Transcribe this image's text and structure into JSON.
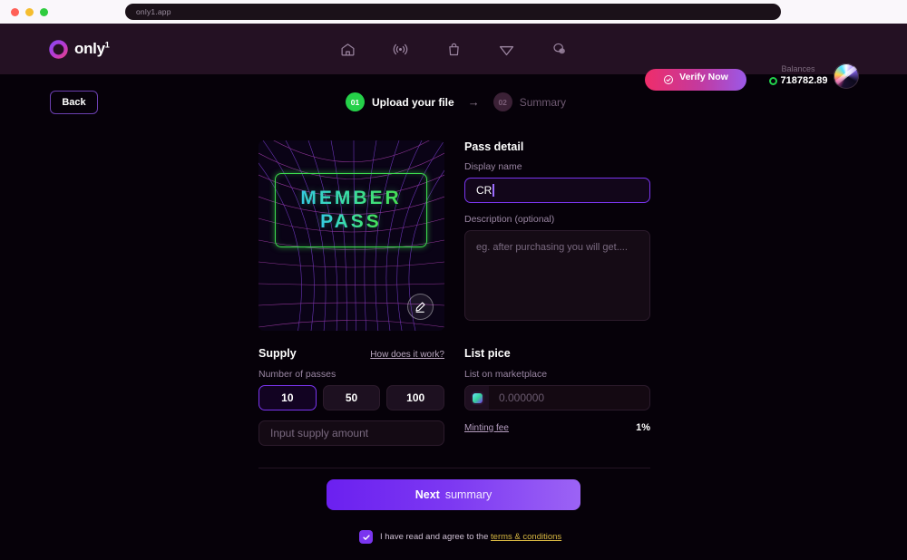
{
  "browser": {
    "url": "only1.app"
  },
  "header": {
    "logo_text": "only",
    "logo_sup": "1",
    "logo_icon": "only1-ring-logo",
    "nav": [
      {
        "name": "home-icon",
        "label": "Home"
      },
      {
        "name": "broadcast-icon",
        "label": "Live"
      },
      {
        "name": "shopping-bag-icon",
        "label": "Shop"
      },
      {
        "name": "diamond-icon",
        "label": "Gems"
      },
      {
        "name": "chat-bubbles-icon",
        "label": "Messages"
      }
    ],
    "verify_label": "Verify Now",
    "verify_icon": "check-circle-icon",
    "balances_label": "Balances",
    "balances_amount": "718782.89",
    "balances_icon": "like-token-icon",
    "avatar_name": "user-avatar"
  },
  "subheader": {
    "back_label": "Back",
    "steps": [
      {
        "number": "01",
        "label": "Upload your file",
        "active": true
      },
      {
        "number": "02",
        "label": "Summary",
        "active": false
      }
    ],
    "arrow": "→"
  },
  "preview": {
    "line1": "MEMBER",
    "line2": "PASS",
    "edit_icon": "pencil-edit-icon"
  },
  "pass_detail": {
    "title": "Pass detail",
    "display_name_label": "Display name",
    "display_name_value": "CR",
    "description_label": "Description (optional)",
    "description_placeholder": "eg. after purchasing you will get....",
    "description_value": ""
  },
  "supply": {
    "title": "Supply",
    "help_link": "How does it work?",
    "field_label": "Number of passes",
    "options": [
      "10",
      "50",
      "100"
    ],
    "selected": "10",
    "input_placeholder": "Input supply amount",
    "input_value": ""
  },
  "list_price": {
    "title": "List pice",
    "field_label": "List on marketplace",
    "price_placeholder": "0.000000",
    "price_value": "",
    "currency_icon": "token-square-icon",
    "fee_link": "Minting fee",
    "fee_value": "1%"
  },
  "footer": {
    "next_bold": "Next",
    "next_rest": "summary",
    "agree_text": "I have read and agree to the",
    "terms_link": "terms & conditions",
    "checkbox_checked": true,
    "check_icon": "checkmark-icon"
  },
  "colors": {
    "page_bg": "#060109",
    "header_bg": "#241123",
    "accent_purple": "#7a35ef",
    "step_green": "#25d049",
    "terms_gold": "#d8b842"
  }
}
